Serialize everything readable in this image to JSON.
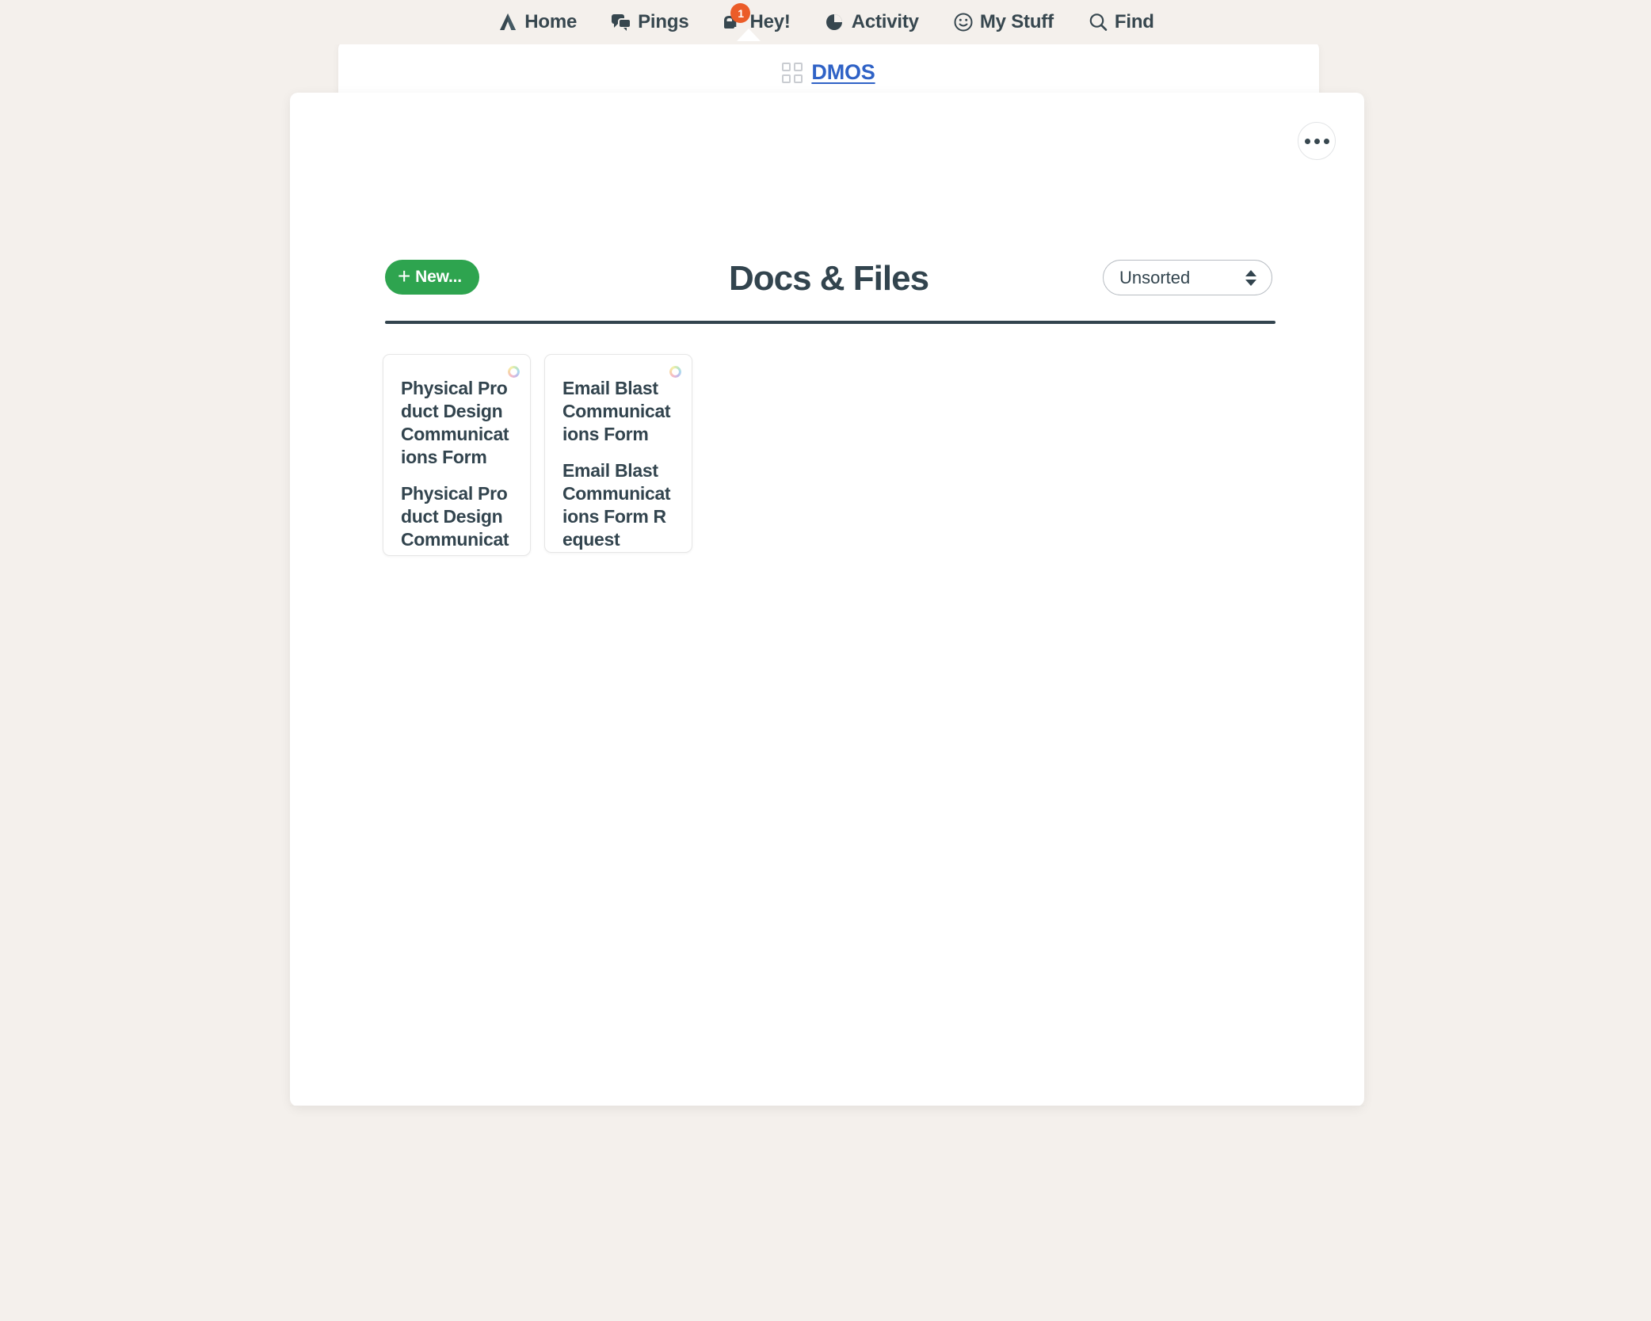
{
  "topnav": {
    "items": [
      {
        "label": "Home",
        "icon": "home-icon"
      },
      {
        "label": "Pings",
        "icon": "chat-bubbles-icon"
      },
      {
        "label": "Hey!",
        "icon": "mailbox-icon",
        "badge": "1"
      },
      {
        "label": "Activity",
        "icon": "pie-clock-icon"
      },
      {
        "label": "My Stuff",
        "icon": "smiley-face-icon"
      },
      {
        "label": "Find",
        "icon": "search-icon"
      }
    ]
  },
  "breadcrumb": {
    "icon": "grid-squares-icon",
    "label": "DMOS"
  },
  "toolbar": {
    "new_label": "New...",
    "new_plus": "+",
    "overflow_label": "...",
    "sort_value": "Unsorted",
    "sort_options": [
      "Unsorted"
    ]
  },
  "page": {
    "title": "Docs & Files"
  },
  "cards": [
    {
      "name": "physical-product-design-communications-form",
      "avatar": "rainbow-ring-icon",
      "lines": [
        "Physical Product Design Communications Form",
        "Physical Product Design Communications Form"
      ]
    },
    {
      "name": "email-blast-communications-form",
      "avatar": "rainbow-ring-icon",
      "lines": [
        "Email Blast Communications Form",
        "Email Blast Communications Form Request"
      ]
    }
  ],
  "colors": {
    "background": "#f4f0ec",
    "panel": "#ffffff",
    "text_dark": "#32444e",
    "link_blue": "#2f62c6",
    "accent_green": "#2ea44f",
    "badge_orange": "#eb5c28",
    "rule_dark": "#32444e"
  }
}
